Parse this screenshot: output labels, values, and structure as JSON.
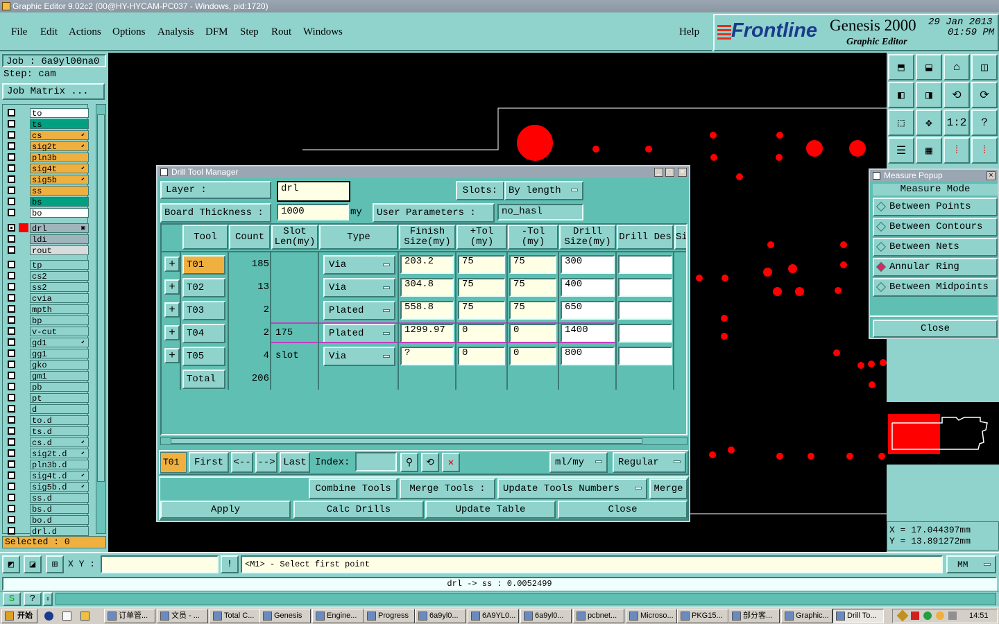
{
  "window": {
    "title": "Graphic Editor 9.02c2 (00@HY-HYCAM-PC037 - Windows, pid:1720)"
  },
  "menu": [
    "File",
    "Edit",
    "Actions",
    "Options",
    "Analysis",
    "DFM",
    "Step",
    "Rout",
    "Windows"
  ],
  "help_label": "Help",
  "brand": {
    "logo": "Frontline",
    "product": "Genesis 2000",
    "subtitle": "Graphic Editor",
    "date": "29 Jan 2013",
    "time": "01:59 PM"
  },
  "left": {
    "job": "Job : 6a9yl00na0",
    "step": "Step: cam",
    "job_matrix": "Job Matrix ...",
    "layers_top": [
      {
        "name": "to",
        "color": "#ffffff",
        "mark": ""
      },
      {
        "name": "ts",
        "color": "#00a080",
        "mark": ""
      },
      {
        "name": "cs",
        "color": "#f0b040",
        "mark": "⬋"
      },
      {
        "name": "sig2t",
        "color": "#f0b040",
        "mark": "⬋"
      },
      {
        "name": "pln3b",
        "color": "#f0b040",
        "mark": ""
      },
      {
        "name": "sig4t",
        "color": "#f0b040",
        "mark": "⬋"
      },
      {
        "name": "sig5b",
        "color": "#f0b040",
        "mark": "⬋"
      },
      {
        "name": "ss",
        "color": "#f0b040",
        "mark": ""
      },
      {
        "name": "bs",
        "color": "#00a080",
        "mark": ""
      },
      {
        "name": "bo",
        "color": "#ffffff",
        "mark": ""
      }
    ],
    "layers_drill": [
      {
        "name": "drl",
        "color": "#a0b4bc",
        "mark": "▣",
        "active": true
      },
      {
        "name": "ldi",
        "color": "#a0b4bc",
        "mark": ""
      },
      {
        "name": "rout",
        "color": "#d8dcdc",
        "mark": ""
      }
    ],
    "layers_misc": [
      {
        "name": "tp",
        "mark": ""
      },
      {
        "name": "cs2",
        "mark": ""
      },
      {
        "name": "ss2",
        "mark": ""
      },
      {
        "name": "cvia",
        "mark": ""
      },
      {
        "name": "mpth",
        "mark": ""
      },
      {
        "name": "bp",
        "mark": ""
      },
      {
        "name": "v-cut",
        "mark": ""
      },
      {
        "name": "gd1",
        "mark": "⬋"
      },
      {
        "name": "gg1",
        "mark": ""
      },
      {
        "name": "gko",
        "mark": ""
      },
      {
        "name": "gm1",
        "mark": ""
      },
      {
        "name": "pb",
        "mark": ""
      },
      {
        "name": "pt",
        "mark": ""
      },
      {
        "name": "d",
        "mark": ""
      },
      {
        "name": "to.d",
        "mark": ""
      },
      {
        "name": "ts.d",
        "mark": ""
      },
      {
        "name": "cs.d",
        "mark": "⬋"
      },
      {
        "name": "sig2t.d",
        "mark": "⬋"
      },
      {
        "name": "pln3b.d",
        "mark": ""
      },
      {
        "name": "sig4t.d",
        "mark": "⬋"
      },
      {
        "name": "sig5b.d",
        "mark": "⬋"
      },
      {
        "name": "ss.d",
        "mark": ""
      },
      {
        "name": "bs.d",
        "mark": ""
      },
      {
        "name": "bo.d",
        "mark": ""
      },
      {
        "name": "drl.d",
        "mark": ""
      }
    ],
    "selected": "Selected : 0"
  },
  "dialog": {
    "title": "Drill Tool Manager",
    "layer_label": "Layer :",
    "layer_value": "drl",
    "slots_label": "Slots:",
    "slots_value": "By length",
    "thickness_label": "Board Thickness :",
    "thickness_value": "1000",
    "thickness_unit": "my",
    "user_params_label": "User Parameters :",
    "user_params_value": "no_hasl",
    "headers": [
      "Tool",
      "Count",
      "Slot Len(my)",
      "Type",
      "Finish Size(my)",
      "+Tol (my)",
      "-Tol (my)",
      "Drill Size(my)",
      "Drill Des",
      "Si"
    ],
    "rows": [
      {
        "tool": "T01",
        "count": "185",
        "slot": "",
        "type": "Via",
        "finish": "203.2",
        "ptol": "75",
        "mtol": "75",
        "drill": "300",
        "des": "",
        "selected": true
      },
      {
        "tool": "T02",
        "count": "13",
        "slot": "",
        "type": "Via",
        "finish": "304.8",
        "ptol": "75",
        "mtol": "75",
        "drill": "400",
        "des": ""
      },
      {
        "tool": "T03",
        "count": "2",
        "slot": "",
        "type": "Plated",
        "finish": "558.8",
        "ptol": "75",
        "mtol": "75",
        "drill": "650",
        "des": ""
      },
      {
        "tool": "T04",
        "count": "2",
        "slot": "175",
        "type": "Plated",
        "finish": "1299.97",
        "ptol": "0",
        "mtol": "0",
        "drill": "1400",
        "des": "",
        "highlight": true
      },
      {
        "tool": "T05",
        "count": "4",
        "slot": "slot",
        "type": "Via",
        "finish": "?",
        "ptol": "0",
        "mtol": "0",
        "drill": "800",
        "des": ""
      }
    ],
    "total_label": "Total",
    "total_value": "206",
    "nav": {
      "current": "T01",
      "first": "First",
      "prev": "<--",
      "next": "-->",
      "last": "Last",
      "index_label": "Index:",
      "units": "ml/my",
      "mode": "Regular"
    },
    "buttons": {
      "combine": "Combine Tools",
      "merge_label": "Merge Tools :",
      "update_numbers": "Update Tools Numbers",
      "merge": "Merge",
      "apply": "Apply",
      "calc": "Calc Drills",
      "update_table": "Update Table",
      "close": "Close"
    }
  },
  "measure": {
    "title": "Measure Popup",
    "mode_label": "Measure Mode",
    "options": [
      {
        "label": "Between Points",
        "on": false
      },
      {
        "label": "Between Contours",
        "on": false
      },
      {
        "label": "Between Nets",
        "on": false
      },
      {
        "label": "Annular Ring",
        "on": true
      },
      {
        "label": "Between Midpoints",
        "on": false
      }
    ],
    "close": "Close"
  },
  "coords": {
    "x": "X = 17.044397mm",
    "y": "Y = 13.891272mm"
  },
  "status": {
    "xy_label": "X Y :",
    "prompt": "<M1> - Select first point",
    "units": "MM",
    "message": "drl -> ss : 0.0052499"
  },
  "taskbar": {
    "start": "开始",
    "tasks": [
      "订单管...",
      "文员 - ...",
      "Total C...",
      "Genesis",
      "Engine...",
      "Progress",
      "6a9yl0...",
      "6A9YL0...",
      "6a9yl0...",
      "pcbnet...",
      "Microso...",
      "PKG15...",
      "部分客...",
      "Graphic...",
      "Drill To..."
    ],
    "clock": "14:51"
  }
}
